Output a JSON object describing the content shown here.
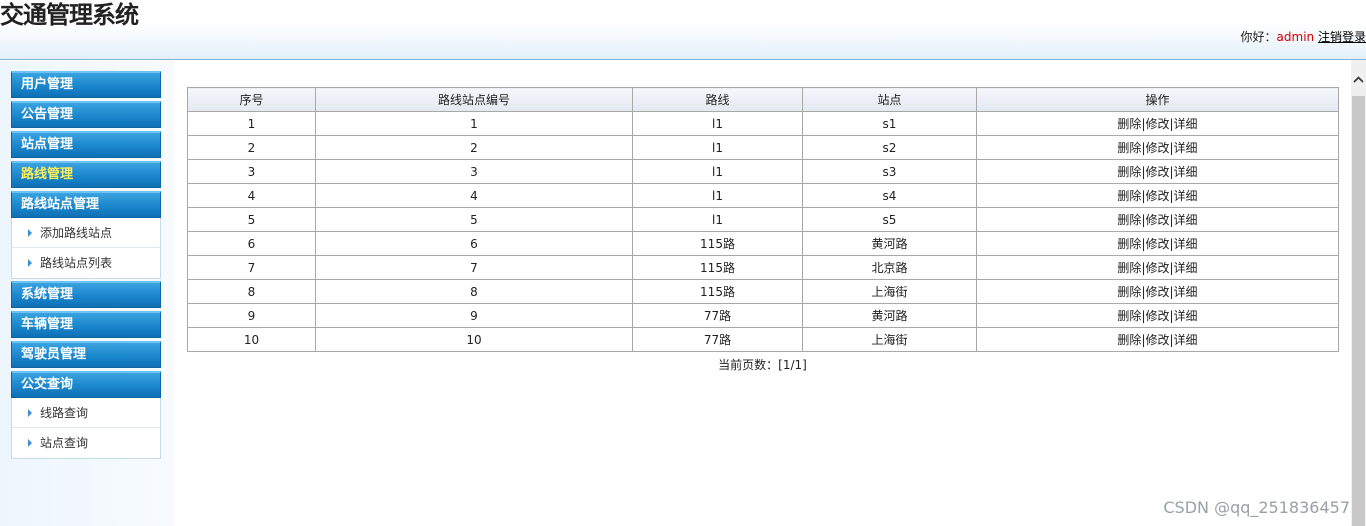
{
  "app": {
    "title": "交通管理系统"
  },
  "userbar": {
    "greeting": "你好：",
    "username": "admin",
    "logout": "注销登录"
  },
  "sidebar": {
    "menus": [
      {
        "label": "用户管理"
      },
      {
        "label": "公告管理"
      },
      {
        "label": "站点管理"
      },
      {
        "label": "路线管理"
      },
      {
        "label": "路线站点管理",
        "items": [
          {
            "label": "添加路线站点"
          },
          {
            "label": "路线站点列表"
          }
        ]
      },
      {
        "label": "系统管理"
      },
      {
        "label": "车辆管理"
      },
      {
        "label": "驾驶员管理"
      },
      {
        "label": "公交查询",
        "items": [
          {
            "label": "线路查询"
          },
          {
            "label": "站点查询"
          }
        ]
      }
    ]
  },
  "table": {
    "headers": [
      "序号",
      "路线站点编号",
      "路线",
      "站点",
      "操作"
    ],
    "ops": {
      "delete": "删除",
      "edit": "修改",
      "detail": "详细",
      "sep": "|"
    },
    "rows": [
      {
        "seq": "1",
        "code": "1",
        "route": "l1",
        "station": "s1"
      },
      {
        "seq": "2",
        "code": "2",
        "route": "l1",
        "station": "s2"
      },
      {
        "seq": "3",
        "code": "3",
        "route": "l1",
        "station": "s3"
      },
      {
        "seq": "4",
        "code": "4",
        "route": "l1",
        "station": "s4"
      },
      {
        "seq": "5",
        "code": "5",
        "route": "l1",
        "station": "s5"
      },
      {
        "seq": "6",
        "code": "6",
        "route": "115路",
        "station": "黄河路"
      },
      {
        "seq": "7",
        "code": "7",
        "route": "115路",
        "station": "北京路"
      },
      {
        "seq": "8",
        "code": "8",
        "route": "115路",
        "station": "上海街"
      },
      {
        "seq": "9",
        "code": "9",
        "route": "77路",
        "station": "黄河路"
      },
      {
        "seq": "10",
        "code": "10",
        "route": "77路",
        "station": "上海街"
      }
    ]
  },
  "pager": {
    "text": "当前页数：[1/1]"
  },
  "watermark": {
    "text": "CSDN @qq_251836457"
  }
}
